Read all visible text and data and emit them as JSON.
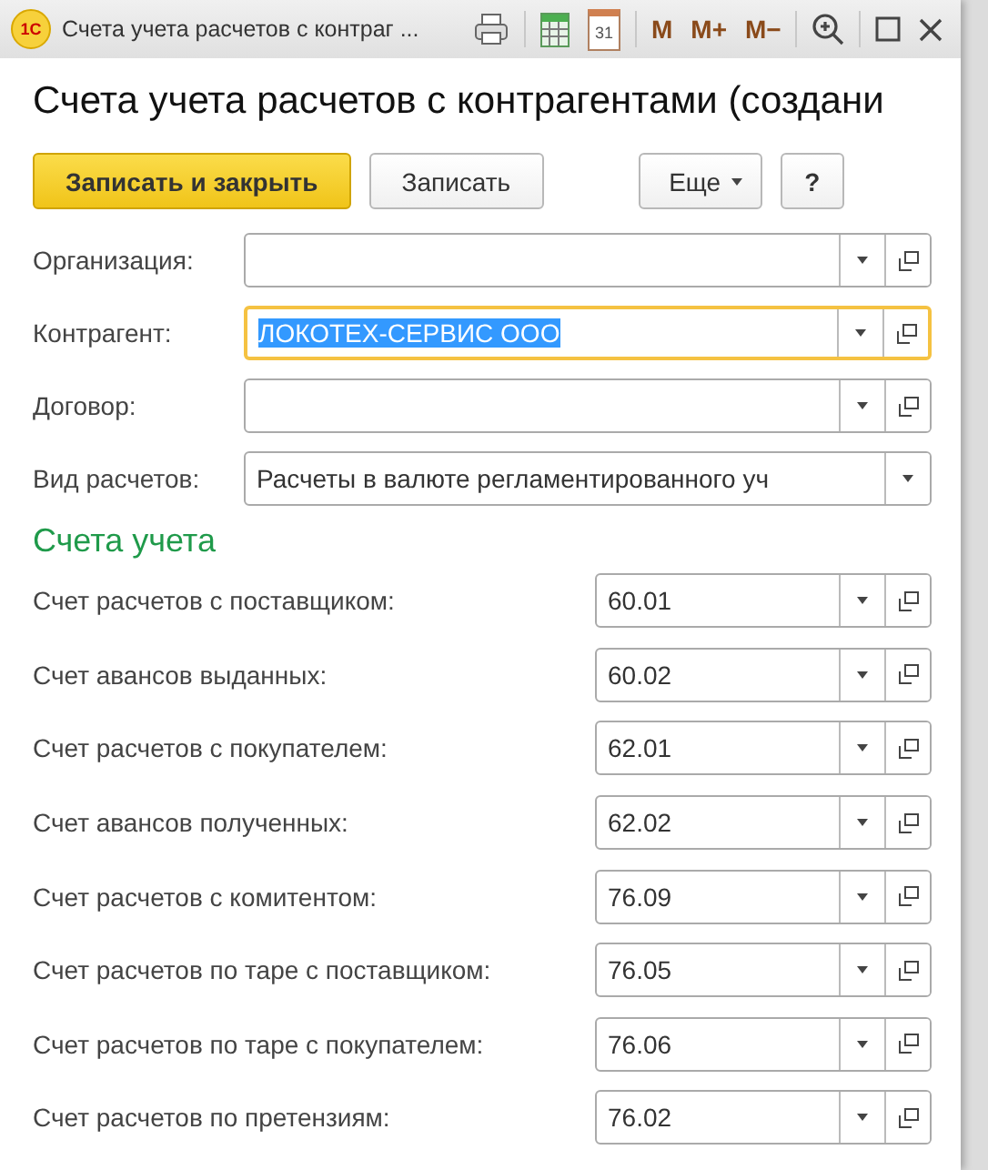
{
  "window": {
    "logo": "1С",
    "title": "Счета учета расчетов с контраг ...",
    "calendar_day": "31",
    "memory_buttons": [
      "M",
      "M+",
      "M−"
    ]
  },
  "form": {
    "heading": "Счета учета расчетов с контрагентами (создани",
    "buttons": [
      {
        "label": "Записать и закрыть",
        "kind": "primary"
      },
      {
        "label": "Записать",
        "kind": "default"
      },
      {
        "label": "Еще",
        "kind": "menu"
      },
      {
        "label": "?",
        "kind": "help"
      }
    ],
    "fields": [
      {
        "label": "Организация:",
        "focused": false,
        "open_button": true
      },
      {
        "label": "Контрагент:",
        "value": "ЛОКОТЕХ-СЕРВИС ООО",
        "focused": true,
        "open_button": true
      },
      {
        "label": "Договор:",
        "focused": false,
        "open_button": true
      },
      {
        "label": "Вид расчетов:",
        "value": "Расчеты в валюте регламентированного уч",
        "focused": false,
        "open_button": false
      }
    ],
    "section_title": "Счета учета",
    "accounts": [
      {
        "label": "Счет расчетов с поставщиком:",
        "value": "60.01"
      },
      {
        "label": "Счет авансов выданных:",
        "value": "60.02"
      },
      {
        "label": "Счет расчетов с покупателем:",
        "value": "62.01"
      },
      {
        "label": "Счет авансов полученных:",
        "value": "62.02"
      },
      {
        "label": "Счет расчетов с комитентом:",
        "value": "76.09"
      },
      {
        "label": "Счет расчетов по таре с поставщиком:",
        "value": "76.05"
      },
      {
        "label": "Счет расчетов по таре с покупателем:",
        "value": "76.06"
      },
      {
        "label": "Счет расчетов по претензиям:",
        "value": "76.02"
      }
    ]
  }
}
